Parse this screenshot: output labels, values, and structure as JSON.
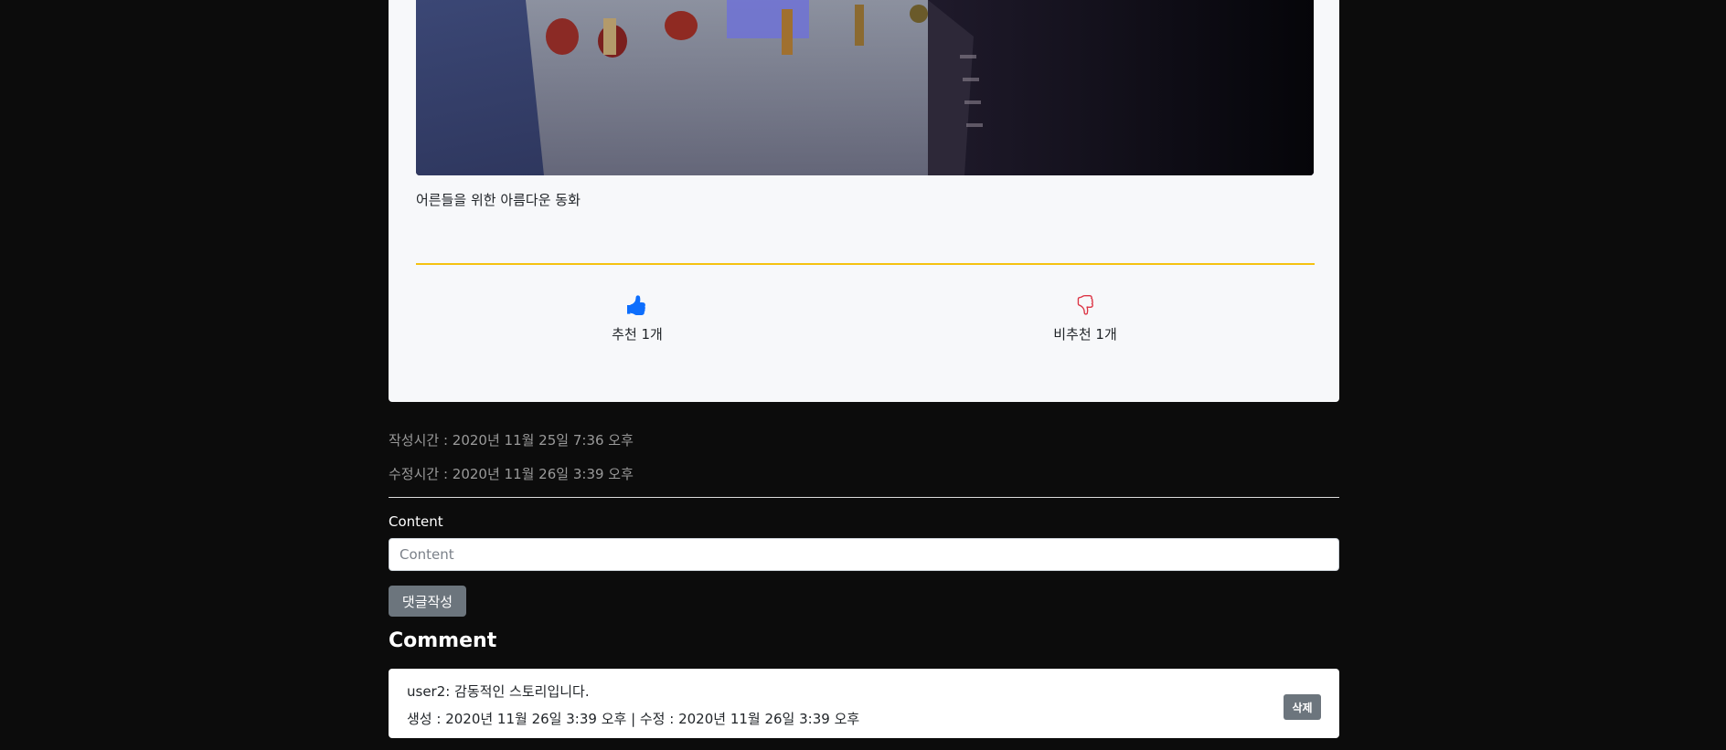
{
  "post": {
    "image_alt": "movie poster",
    "description": "어른들을 위한 아름다운 동화",
    "recommend": {
      "label": "추천 1개",
      "icon": "thumbs-up-icon",
      "color": "#0d6efd"
    },
    "not_recommend": {
      "label": "비추천 1개",
      "icon": "thumbs-down-icon",
      "color": "#dc3545"
    },
    "created": "작성시간 : 2020년 11월 25일 7:36 오후",
    "modified": "수정시간 : 2020년 11월 26일 3:39 오후"
  },
  "comment_form": {
    "label": "Content",
    "placeholder": "Content",
    "value": "",
    "submit_label": "댓글작성"
  },
  "comments": {
    "heading": "Comment",
    "items": [
      {
        "text": "user2: 감동적인 스토리입니다.",
        "meta": "생성 : 2020년 11월 26일 3:39 오후 | 수정 : 2020년 11월 26일 3:39 오후",
        "delete_label": "삭제"
      }
    ]
  },
  "colors": {
    "background": "#0c0c0c",
    "card": "#f7f8fa",
    "divider": "#f5c211",
    "button": "#6c757d"
  }
}
